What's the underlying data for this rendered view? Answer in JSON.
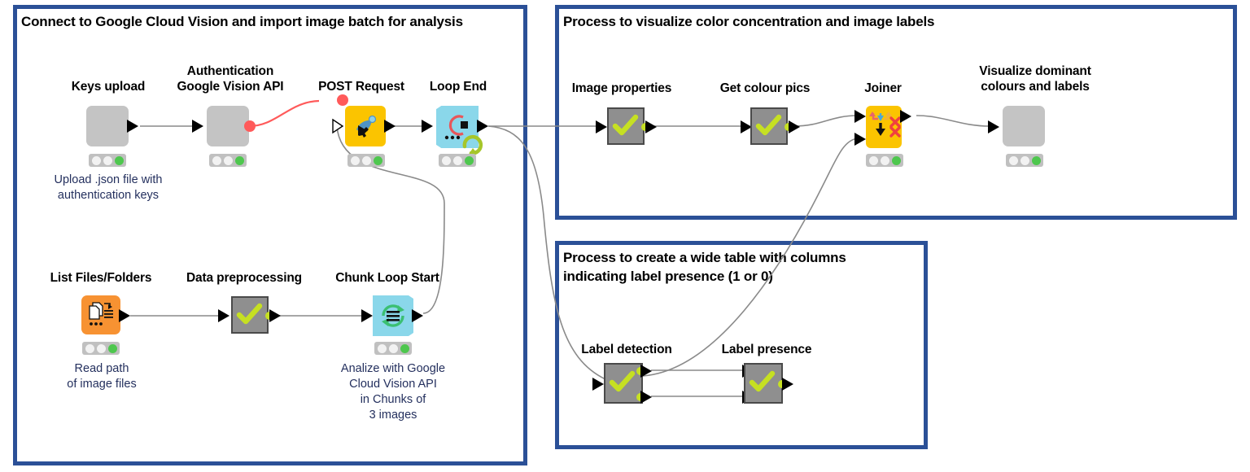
{
  "app": {
    "type": "knime-workflow-canvas",
    "background": "#ffffff",
    "panel_border_color": "#2b5097",
    "accent_colors": {
      "node_yellow": "#fbc400",
      "node_orange": "#f79232",
      "node_cyan": "#8ad7ea",
      "node_gray": "#c4c4c4",
      "metanode_gray": "#8f8f8f",
      "status_green": "#4ec74e",
      "check_green": "#c6e022",
      "port_yellow": "#c6e022",
      "error_red": "#ff4d4d",
      "wire_gray": "#7a7a7a"
    }
  },
  "panels": [
    {
      "id": "panel-connect",
      "title": "Connect to Google Cloud Vision and import image batch for analysis"
    },
    {
      "id": "panel-visualize",
      "title": "Process to visualize color concentration and image labels"
    },
    {
      "id": "panel-wide-table",
      "title": "Process to create a wide table with columns indicating label presence (1 or 0)"
    }
  ],
  "nodes": [
    {
      "id": "keys-upload",
      "label": "Keys upload",
      "description": "Upload .json file with\nauthentication keys",
      "style": "plain-gray",
      "status": "green",
      "panel": "panel-connect"
    },
    {
      "id": "authentication-google-vision-api",
      "label": "Authentication\nGoogle Vision API",
      "description": "",
      "style": "plain-gray",
      "status": "green",
      "panel": "panel-connect"
    },
    {
      "id": "post-request",
      "label": "POST Request",
      "description": "",
      "style": "yellow",
      "status": "green",
      "panel": "panel-connect"
    },
    {
      "id": "loop-end",
      "label": "Loop End",
      "description": "",
      "style": "cyan-loop-end",
      "status": "green",
      "panel": "panel-connect"
    },
    {
      "id": "list-files-folders",
      "label": "List Files/Folders",
      "description": "Read path\nof image files",
      "style": "orange",
      "status": "green",
      "panel": "panel-connect"
    },
    {
      "id": "data-preprocessing",
      "label": "Data preprocessing",
      "description": "",
      "style": "metanode",
      "status": "none",
      "panel": "panel-connect"
    },
    {
      "id": "chunk-loop-start",
      "label": "Chunk Loop Start",
      "description": "Analize with Google\nCloud Vision API\nin Chunks of\n3 images",
      "style": "cyan-loop-start",
      "status": "green",
      "panel": "panel-connect"
    },
    {
      "id": "image-properties",
      "label": "Image properties",
      "description": "",
      "style": "metanode",
      "status": "none",
      "panel": "panel-visualize"
    },
    {
      "id": "get-colour-pics",
      "label": "Get colour pics",
      "description": "",
      "style": "metanode",
      "status": "none",
      "panel": "panel-visualize"
    },
    {
      "id": "joiner",
      "label": "Joiner",
      "description": "",
      "style": "yellow",
      "status": "green",
      "panel": "panel-visualize"
    },
    {
      "id": "visualize-dominant-colours-and-labels",
      "label": "Visualize dominant\ncolours and labels",
      "description": "",
      "style": "plain-gray",
      "status": "green",
      "panel": "panel-visualize"
    },
    {
      "id": "label-detection",
      "label": "Label detection",
      "description": "",
      "style": "metanode",
      "status": "none",
      "panel": "panel-wide-table"
    },
    {
      "id": "label-presence",
      "label": "Label presence",
      "description": "",
      "style": "metanode",
      "status": "none",
      "panel": "panel-wide-table"
    }
  ],
  "connections": [
    {
      "from": "keys-upload",
      "to": "authentication-google-vision-api",
      "color": "gray"
    },
    {
      "from": "authentication-google-vision-api",
      "to": "post-request",
      "color": "red"
    },
    {
      "from": "post-request",
      "to": "loop-end",
      "color": "gray"
    },
    {
      "from": "chunk-loop-start",
      "to": "post-request",
      "color": "gray"
    },
    {
      "from": "list-files-folders",
      "to": "data-preprocessing",
      "color": "gray"
    },
    {
      "from": "data-preprocessing",
      "to": "chunk-loop-start",
      "color": "gray"
    },
    {
      "from": "loop-end",
      "to": "image-properties",
      "color": "gray"
    },
    {
      "from": "loop-end",
      "to": "label-detection",
      "color": "gray"
    },
    {
      "from": "image-properties",
      "to": "get-colour-pics",
      "color": "gray"
    },
    {
      "from": "get-colour-pics",
      "to": "joiner",
      "color": "gray"
    },
    {
      "from": "label-detection",
      "to": "joiner",
      "color": "gray"
    },
    {
      "from": "joiner",
      "to": "visualize-dominant-colours-and-labels",
      "color": "gray"
    },
    {
      "from": "label-detection",
      "to": "label-presence",
      "color": "gray"
    },
    {
      "from": "label-detection",
      "to": "label-presence",
      "color": "gray"
    }
  ]
}
